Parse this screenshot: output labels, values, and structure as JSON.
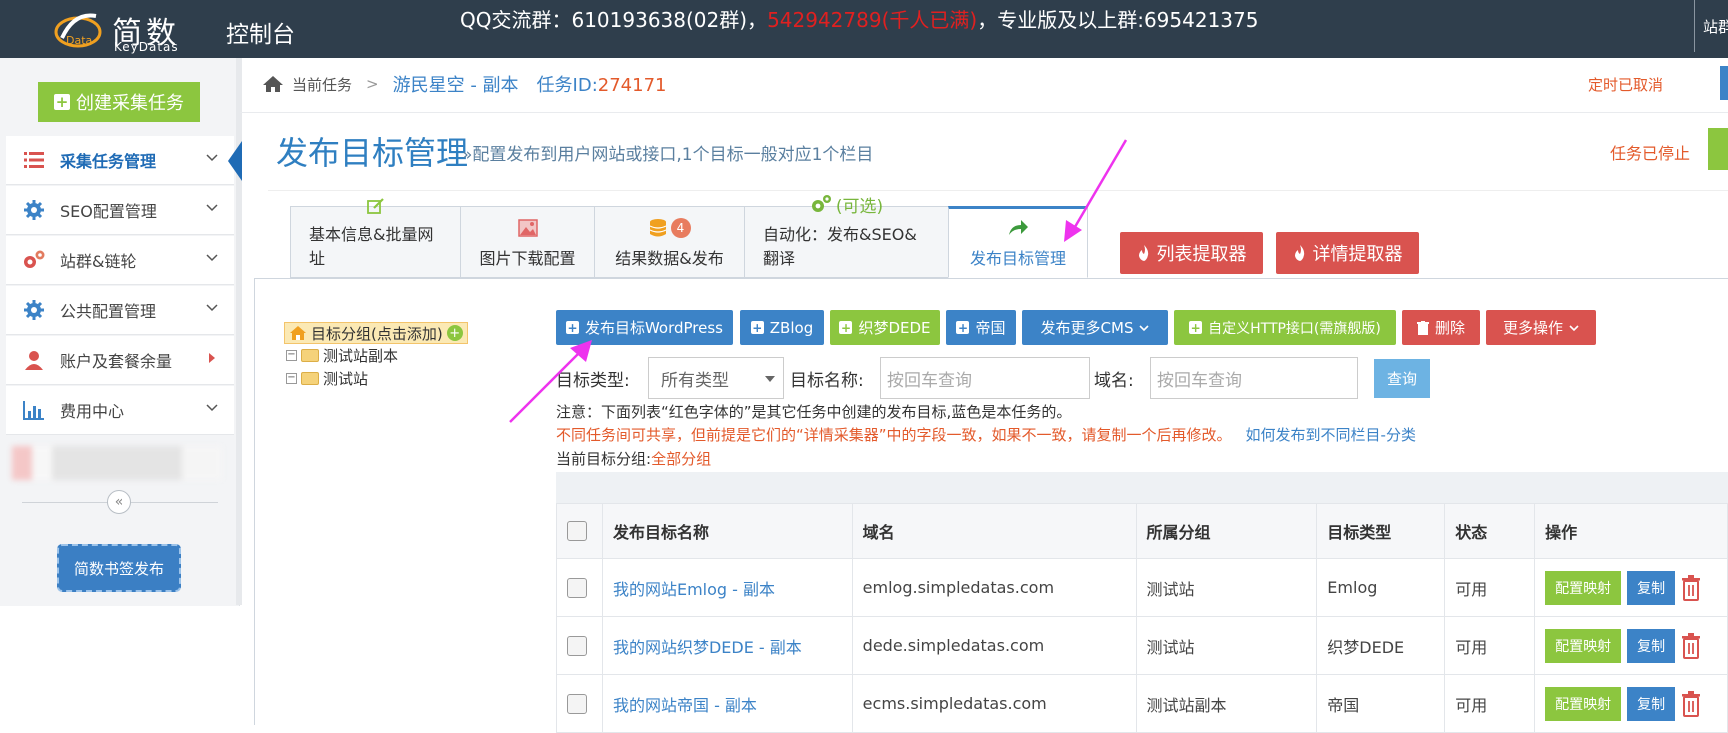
{
  "header": {
    "logo_cn": "简数",
    "logo_en": "KeyDatas",
    "console": "控制台",
    "qq_prefix": "QQ交流群：610193638(02群)，",
    "qq_full": "542942789(千人已满)",
    "qq_suffix": "，专业版及以上群:695421375",
    "top_right": "站群"
  },
  "sidebar": {
    "create_button": "创建采集任务",
    "items": [
      {
        "label": "采集任务管理",
        "icon": "list-icon"
      },
      {
        "label": "SEO配置管理",
        "icon": "gear-icon"
      },
      {
        "label": "站群&链轮",
        "icon": "gears-icon"
      },
      {
        "label": "公共配置管理",
        "icon": "gear-icon"
      },
      {
        "label": "账户及套餐余量",
        "icon": "user-icon"
      },
      {
        "label": "费用中心",
        "icon": "bar-chart-icon"
      }
    ],
    "collapse_glyph": "«",
    "bookmark_button": "简数书签发布"
  },
  "breadcrumb": {
    "current": "当前任务",
    "task_name": "游民星空 - 副本",
    "task_id_label": "任务ID:",
    "task_id": "274171",
    "timer_status": "定时已取消"
  },
  "page": {
    "title": "发布目标管理",
    "subtitle": "»配置发布到用户网站或接口,1个目标一般对应1个栏目",
    "task_status": "任务已停止"
  },
  "tabs": [
    {
      "label": "基本信息&批量网址"
    },
    {
      "label": "图片下载配置"
    },
    {
      "label": "结果数据&发布",
      "badge": "4"
    },
    {
      "label": "自动化：发布&SEO&翻译",
      "icon_text": "(可选)"
    },
    {
      "label": "发布目标管理"
    }
  ],
  "extractors": {
    "list": "列表提取器",
    "detail": "详情提取器"
  },
  "tree": {
    "root": "目标分组(点击添加)",
    "nodes": [
      "测试站副本",
      "测试站"
    ]
  },
  "toolbar": {
    "wordpress": "发布目标WordPress",
    "zblog": "ZBlog",
    "dede": "织梦DEDE",
    "diguo": "帝国",
    "more_cms": "发布更多CMS",
    "custom_http": "自定义HTTP接口(需旗舰版)",
    "delete": "删除",
    "more_ops": "更多操作"
  },
  "filter": {
    "type_label": "目标类型:",
    "type_value": "所有类型",
    "name_label": "目标名称:",
    "name_placeholder": "按回车查询",
    "domain_label": "域名:",
    "domain_placeholder": "按回车查询",
    "query_button": "查询"
  },
  "notes": {
    "note1": "注意：下面列表“红色字体的”是其它任务中创建的发布目标,蓝色是本任务的。",
    "note2": "不同任务间可共享，但前提是它们的“详情采集器”中的字段一致，如果不一致，请复制一个后再修改。",
    "note2_link": "如何发布到不同栏目-分类",
    "note3_label": "当前目标分组:",
    "note3_value": "全部分组"
  },
  "table": {
    "headers": [
      "发布目标名称",
      "域名",
      "所属分组",
      "目标类型",
      "状态",
      "操作"
    ],
    "rows": [
      {
        "name": "我的网站Emlog - 副本",
        "domain": "emlog.simpledatas.com",
        "group": "测试站",
        "type": "Emlog",
        "status": "可用"
      },
      {
        "name": "我的网站织梦DEDE - 副本",
        "domain": "dede.simpledatas.com",
        "group": "测试站",
        "type": "织梦DEDE",
        "status": "可用"
      },
      {
        "name": "我的网站帝国 - 副本",
        "domain": "ecms.simpledatas.com",
        "group": "测试站副本",
        "type": "帝国",
        "status": "可用"
      }
    ],
    "map_button": "配置映射",
    "copy_button": "复制"
  },
  "colors": {
    "topbar": "#2f3e4c",
    "accent_blue": "#3c83c7",
    "accent_green": "#8cc63f",
    "accent_red": "#d9534f",
    "warning_text": "#e35a2b",
    "annotation_arrow": "#ee33ee"
  }
}
